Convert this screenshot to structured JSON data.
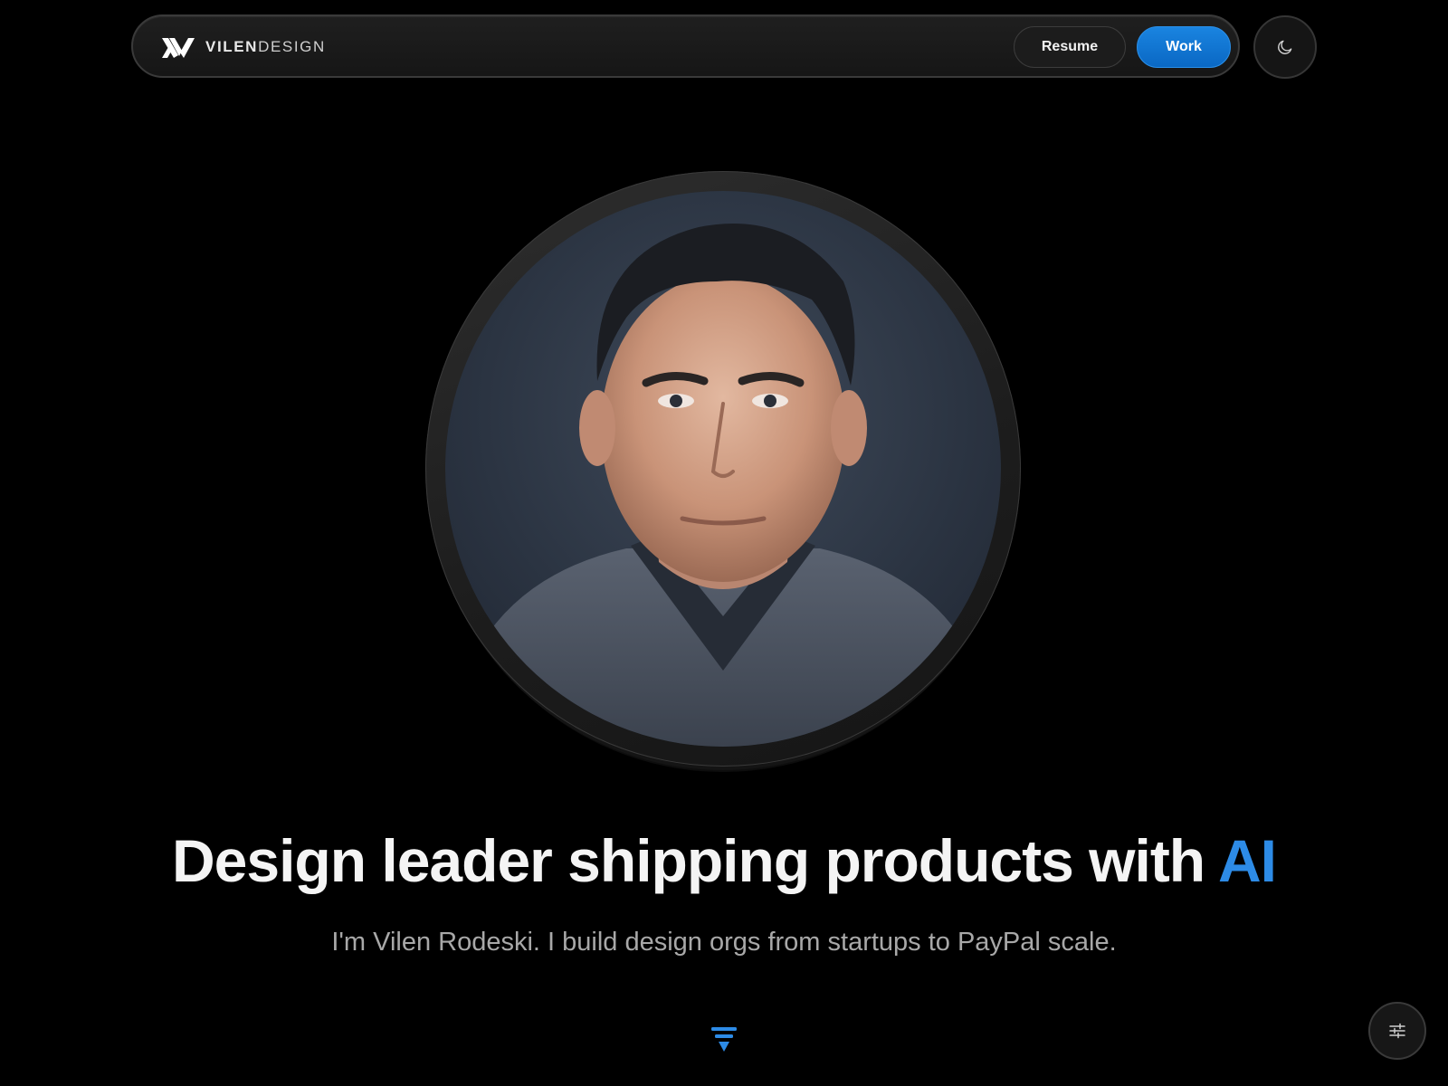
{
  "header": {
    "logo": {
      "mark_icon": "vilen-monogram-logo",
      "name_bold": "VILEN",
      "name_light": "DESIGN"
    },
    "nav_buttons": [
      {
        "label": "Resume",
        "style": "secondary"
      },
      {
        "label": "Work",
        "style": "primary"
      }
    ],
    "theme_toggle_icon": "moon-icon"
  },
  "hero": {
    "portrait_alt": "Portrait photo",
    "headline_main": "Design leader shipping products with ",
    "headline_accent": "AI",
    "subline": "I'm Vilen Rodeski. I build design orgs from startups to PayPal scale."
  },
  "controls": {
    "scroll_indicator_icon": "chevron-down-icon",
    "settings_icon": "sliders-icon"
  },
  "colors": {
    "background": "#000000",
    "accent": "#2d8be6",
    "primary_button": "#0a6fd0",
    "text_primary": "#f4f4f4",
    "text_secondary": "#a8a8a8"
  }
}
